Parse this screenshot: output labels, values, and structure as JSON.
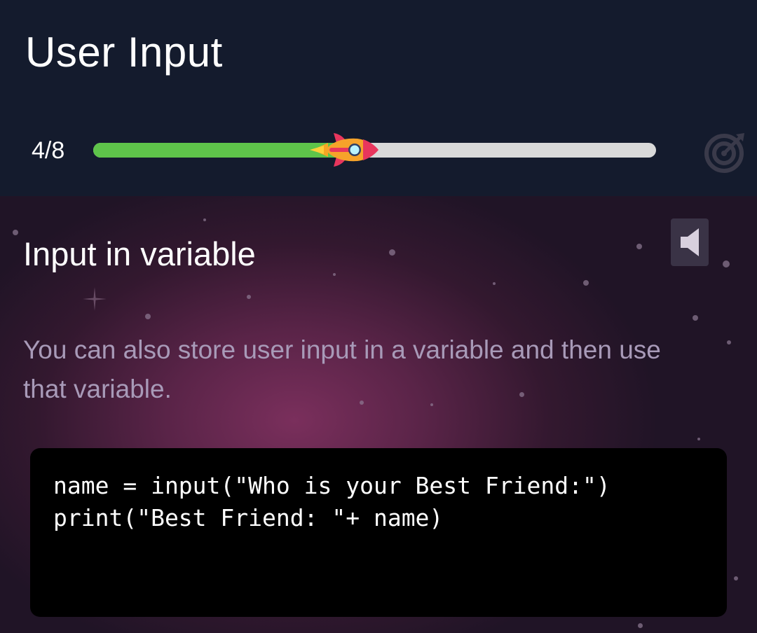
{
  "header": {
    "title": "User Input",
    "progress": {
      "label": "4/8",
      "current": 4,
      "total": 8
    },
    "target_icon": "target-arrow-icon"
  },
  "lesson": {
    "title": "Input in variable",
    "speaker_icon": "speaker-icon",
    "description": "You can also store user input in a variable and then use that variable.",
    "code": [
      "name = input(\"Who is your Best Friend:\")",
      "print(\"Best Friend: \"+ name)"
    ]
  },
  "colors": {
    "header_bg": "#141b2d",
    "progress_fill": "#5ec44a",
    "progress_track": "#d9d9d9",
    "description_text": "#a89ab8",
    "code_bg": "#000000"
  }
}
